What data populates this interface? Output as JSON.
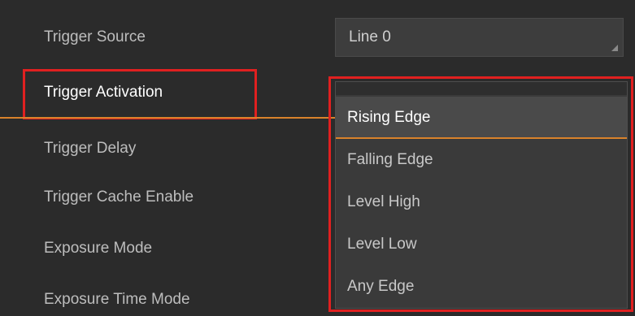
{
  "labels": [
    "Trigger Source",
    "Trigger Activation",
    "Trigger Delay",
    "Trigger Cache Enable",
    "Exposure Mode",
    "Exposure Time Mode"
  ],
  "trigger_source_value": "Line 0",
  "dropdown": {
    "options": [
      "Rising Edge",
      "Falling Edge",
      "Level High",
      "Level Low",
      "Any Edge"
    ],
    "selected": "Rising Edge"
  },
  "colors": {
    "highlight_box": "#e02020",
    "accent_line": "#d9822b",
    "background": "#2b2b2b"
  }
}
